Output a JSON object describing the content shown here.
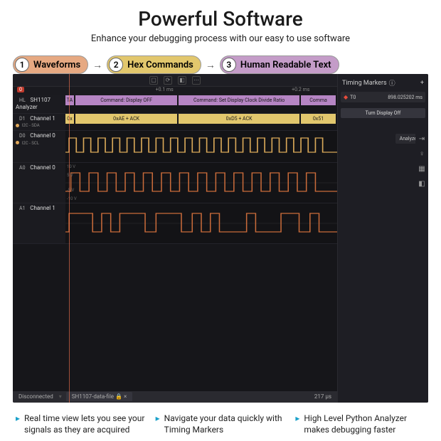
{
  "hero": {
    "title": "Powerful Software",
    "subtitle": "Enhance your debugging process with our easy to use software"
  },
  "callouts": [
    {
      "num": "1",
      "label": "Waveforms"
    },
    {
      "num": "2",
      "label": "Hex Commands"
    },
    {
      "num": "3",
      "label": "Human Readable Text"
    }
  ],
  "arrow_glyph": "→",
  "ruler": {
    "zero": "0",
    "t1": "+0.1 ms",
    "t2": "+0.2 ms"
  },
  "channels": {
    "hl": {
      "tag": "HL",
      "name": "SH1107 Analyzer"
    },
    "d1": {
      "tag": "D1",
      "name": "Channel 1",
      "sub": "I2C - SDA"
    },
    "d0": {
      "tag": "D0",
      "name": "Channel 0",
      "sub": "I2C - SCL"
    },
    "a0": {
      "tag": "A0",
      "name": "Channel 0"
    },
    "a1": {
      "tag": "A1",
      "name": "Channel 1"
    }
  },
  "proto_blocks": {
    "b0": "TA",
    "b1": "Command: Display OFF",
    "b2": "Command: Set Display Clock Divide Ratio",
    "b3": "Comma"
  },
  "data_blocks": {
    "b0": "0x",
    "b1": "0xAE + ACK",
    "b2": "0xD5 + ACK",
    "b3": "0x51"
  },
  "analog_ticks": {
    "p10": "10 V",
    "p5": "5 V",
    "n5": "-5 V",
    "n10": "-10 V"
  },
  "side": {
    "title": "Timing Markers",
    "marker_label": "T0",
    "marker_value": "898.025202 ms",
    "action": "Turn Display Off",
    "analyzers": "Analyzers",
    "plus": "+",
    "info": "ⓘ"
  },
  "status": {
    "disconnected": "Disconnected",
    "tab": "SH1107-data-file",
    "lock": "🔒",
    "close": "×",
    "zoom": "217 µs"
  },
  "bullets": [
    "Real time view lets you see your signals as they are acquired",
    "Navigate your data quickly with Timing Markers",
    "High Level Python Analyzer makes debugging faster"
  ]
}
